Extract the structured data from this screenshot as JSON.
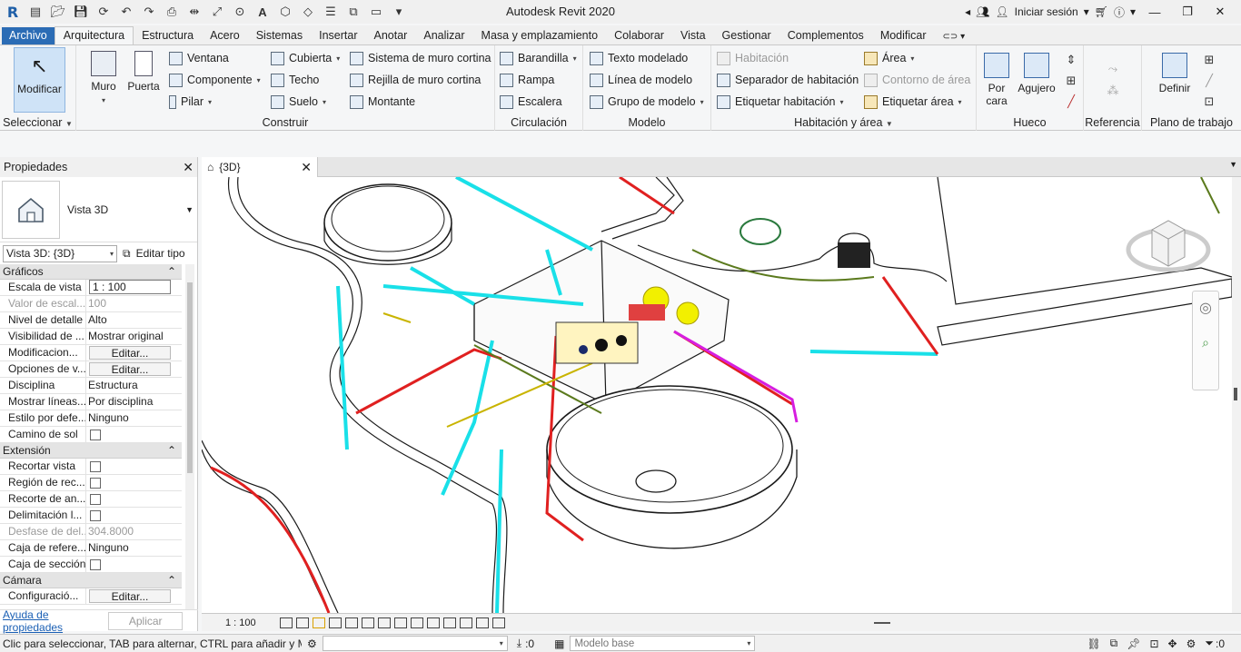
{
  "app": {
    "title": "Autodesk Revit 2020",
    "logo_letter": "R"
  },
  "title_right": {
    "sign_in": "Iniciar sesión"
  },
  "tabs": [
    "Archivo",
    "Arquitectura",
    "Estructura",
    "Acero",
    "Sistemas",
    "Insertar",
    "Anotar",
    "Analizar",
    "Masa y emplazamiento",
    "Colaborar",
    "Vista",
    "Gestionar",
    "Complementos",
    "Modificar"
  ],
  "ribbon": {
    "seleccionar": {
      "big": "Modificar",
      "title": "Seleccionar"
    },
    "construir": {
      "title": "Construir",
      "muro": "Muro",
      "puerta": "Puerta",
      "col1": [
        "Ventana",
        "Componente",
        "Pilar"
      ],
      "col2": [
        "Cubierta",
        "Techo",
        "Suelo"
      ],
      "col3": [
        "Sistema de muro cortina",
        "Rejilla de muro cortina",
        "Montante"
      ]
    },
    "circulacion": {
      "title": "Circulación",
      "items": [
        "Barandilla",
        "Rampa",
        "Escalera"
      ]
    },
    "modelo": {
      "title": "Modelo",
      "items": [
        "Texto modelado",
        "Línea de modelo",
        "Grupo de modelo"
      ]
    },
    "habitacion": {
      "title": "Habitación y área",
      "col1": [
        "Habitación",
        "Separador de habitación",
        "Etiquetar habitación"
      ],
      "col2": [
        "Área",
        "Contorno de área",
        "Etiquetar área"
      ]
    },
    "hueco": {
      "title": "Hueco",
      "por_cara": "Por cara",
      "agujero": "Agujero"
    },
    "referencia": {
      "title": "Referencia"
    },
    "plano": {
      "title": "Plano de trabajo",
      "definir": "Definir"
    }
  },
  "properties": {
    "header": "Propiedades",
    "type_name": "Vista 3D",
    "instance": "Vista 3D: {3D}",
    "edit_type": "Editar tipo",
    "sections": [
      {
        "name": "Gráficos",
        "rows": [
          {
            "label": "Escala de vista",
            "value": "1 : 100",
            "kind": "input"
          },
          {
            "label": "Valor de escal...",
            "value": "100",
            "kind": "gray"
          },
          {
            "label": "Nivel de detalle",
            "value": "Alto",
            "kind": "text"
          },
          {
            "label": "Visibilidad de ...",
            "value": "Mostrar original",
            "kind": "text"
          },
          {
            "label": "Modificacion...",
            "value": "Editar...",
            "kind": "button"
          },
          {
            "label": "Opciones de v...",
            "value": "Editar...",
            "kind": "button"
          },
          {
            "label": "Disciplina",
            "value": "Estructura",
            "kind": "text"
          },
          {
            "label": "Mostrar líneas...",
            "value": "Por disciplina",
            "kind": "text"
          },
          {
            "label": "Estilo por defe...",
            "value": "Ninguno",
            "kind": "text"
          },
          {
            "label": "Camino de sol",
            "value": "",
            "kind": "check"
          }
        ]
      },
      {
        "name": "Extensión",
        "rows": [
          {
            "label": "Recortar vista",
            "value": "",
            "kind": "check"
          },
          {
            "label": "Región de rec...",
            "value": "",
            "kind": "check"
          },
          {
            "label": "Recorte de an...",
            "value": "",
            "kind": "check"
          },
          {
            "label": "Delimitación l...",
            "value": "",
            "kind": "check"
          },
          {
            "label": "Desfase de del...",
            "value": "304.8000",
            "kind": "gray"
          },
          {
            "label": "Caja de refere...",
            "value": "Ninguno",
            "kind": "text"
          },
          {
            "label": "Caja de sección",
            "value": "",
            "kind": "check"
          }
        ]
      },
      {
        "name": "Cámara",
        "rows": [
          {
            "label": "Configuració...",
            "value": "Editar...",
            "kind": "button"
          }
        ]
      }
    ],
    "help": "Ayuda de propiedades",
    "apply": "Aplicar"
  },
  "view": {
    "tab": "{3D}",
    "scale": "1 : 100"
  },
  "status": {
    "message": "Clic para seleccionar, TAB para alternar, CTRL para añadir y MAYÚS",
    "count_left": ":0",
    "model": "Modelo base",
    "count_right": ":0"
  }
}
